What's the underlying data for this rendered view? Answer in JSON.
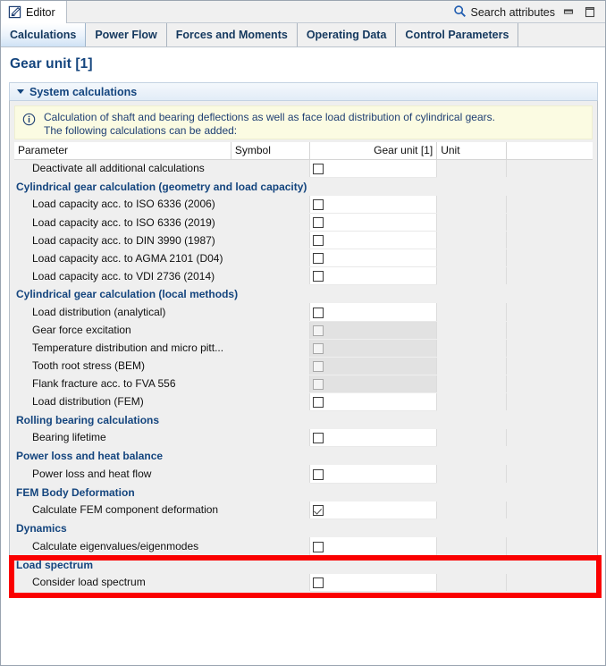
{
  "window": {
    "editor_tab_label": "Editor",
    "editor_icon": "editor-pencil-icon",
    "search_label": "Search attributes",
    "search_icon": "search-icon",
    "minimize_icon": "minimize-icon",
    "maximize_icon": "maximize-icon"
  },
  "tabs": [
    {
      "label": "Calculations",
      "active": true
    },
    {
      "label": "Power Flow",
      "active": false
    },
    {
      "label": "Forces and Moments",
      "active": false
    },
    {
      "label": "Operating Data",
      "active": false
    },
    {
      "label": "Control Parameters",
      "active": false
    }
  ],
  "page": {
    "title": "Gear unit [1]"
  },
  "section": {
    "title": "System calculations",
    "expanded": true,
    "twisty_icon": "chevron-down-icon"
  },
  "info": {
    "icon": "info-icon",
    "line1": "Calculation of shaft and bearing deflections as well as face load distribution of cylindrical gears.",
    "line2": "The following calculations can be added:"
  },
  "table": {
    "headers": [
      "Parameter",
      "Symbol",
      "Gear unit [1]",
      "Unit",
      ""
    ],
    "rows": [
      {
        "kind": "item",
        "label": "Deactivate all additional calculations",
        "symbol": "",
        "checked": false,
        "disabled": false,
        "unit": ""
      },
      {
        "kind": "group",
        "label": "Cylindrical gear calculation (geometry and load capacity)"
      },
      {
        "kind": "item",
        "label": "Load capacity acc. to ISO 6336 (2006)",
        "symbol": "",
        "checked": false,
        "disabled": false,
        "unit": ""
      },
      {
        "kind": "item",
        "label": "Load capacity acc. to ISO 6336 (2019)",
        "symbol": "",
        "checked": false,
        "disabled": false,
        "unit": ""
      },
      {
        "kind": "item",
        "label": "Load capacity acc. to DIN 3990 (1987)",
        "symbol": "",
        "checked": false,
        "disabled": false,
        "unit": ""
      },
      {
        "kind": "item",
        "label": "Load capacity acc. to AGMA 2101 (D04)",
        "symbol": "",
        "checked": false,
        "disabled": false,
        "unit": ""
      },
      {
        "kind": "item",
        "label": "Load capacity acc. to VDI 2736 (2014)",
        "symbol": "",
        "checked": false,
        "disabled": false,
        "unit": ""
      },
      {
        "kind": "group",
        "label": "Cylindrical gear calculation (local methods)"
      },
      {
        "kind": "item",
        "label": "Load distribution (analytical)",
        "symbol": "",
        "checked": false,
        "disabled": false,
        "unit": ""
      },
      {
        "kind": "item",
        "label": "Gear force excitation",
        "symbol": "",
        "checked": false,
        "disabled": true,
        "unit": ""
      },
      {
        "kind": "item",
        "label": "Temperature distribution and micro pitt...",
        "symbol": "",
        "checked": false,
        "disabled": true,
        "unit": ""
      },
      {
        "kind": "item",
        "label": "Tooth root stress (BEM)",
        "symbol": "",
        "checked": false,
        "disabled": true,
        "unit": ""
      },
      {
        "kind": "item",
        "label": "Flank fracture acc. to FVA 556",
        "symbol": "",
        "checked": false,
        "disabled": true,
        "unit": ""
      },
      {
        "kind": "item",
        "label": "Load distribution (FEM)",
        "symbol": "",
        "checked": false,
        "disabled": false,
        "unit": ""
      },
      {
        "kind": "group",
        "label": "Rolling bearing calculations"
      },
      {
        "kind": "item",
        "label": "Bearing lifetime",
        "symbol": "",
        "checked": false,
        "disabled": false,
        "unit": ""
      },
      {
        "kind": "group",
        "label": "Power loss and heat balance"
      },
      {
        "kind": "item",
        "label": "Power loss and heat flow",
        "symbol": "",
        "checked": false,
        "disabled": false,
        "unit": ""
      },
      {
        "kind": "group",
        "label": "FEM Body Deformation"
      },
      {
        "kind": "item",
        "label": "Calculate FEM component deformation",
        "symbol": "",
        "checked": true,
        "disabled": false,
        "unit": ""
      },
      {
        "kind": "group",
        "label": "Dynamics"
      },
      {
        "kind": "item",
        "label": "Calculate eigenvalues/eigenmodes",
        "symbol": "",
        "checked": false,
        "disabled": false,
        "unit": ""
      },
      {
        "kind": "group",
        "label": "Load spectrum"
      },
      {
        "kind": "item",
        "label": "Consider load spectrum",
        "symbol": "",
        "checked": false,
        "disabled": false,
        "unit": ""
      }
    ]
  },
  "annotation": {
    "name": "fem-body-deformation-highlight",
    "color": "#fa0000"
  }
}
